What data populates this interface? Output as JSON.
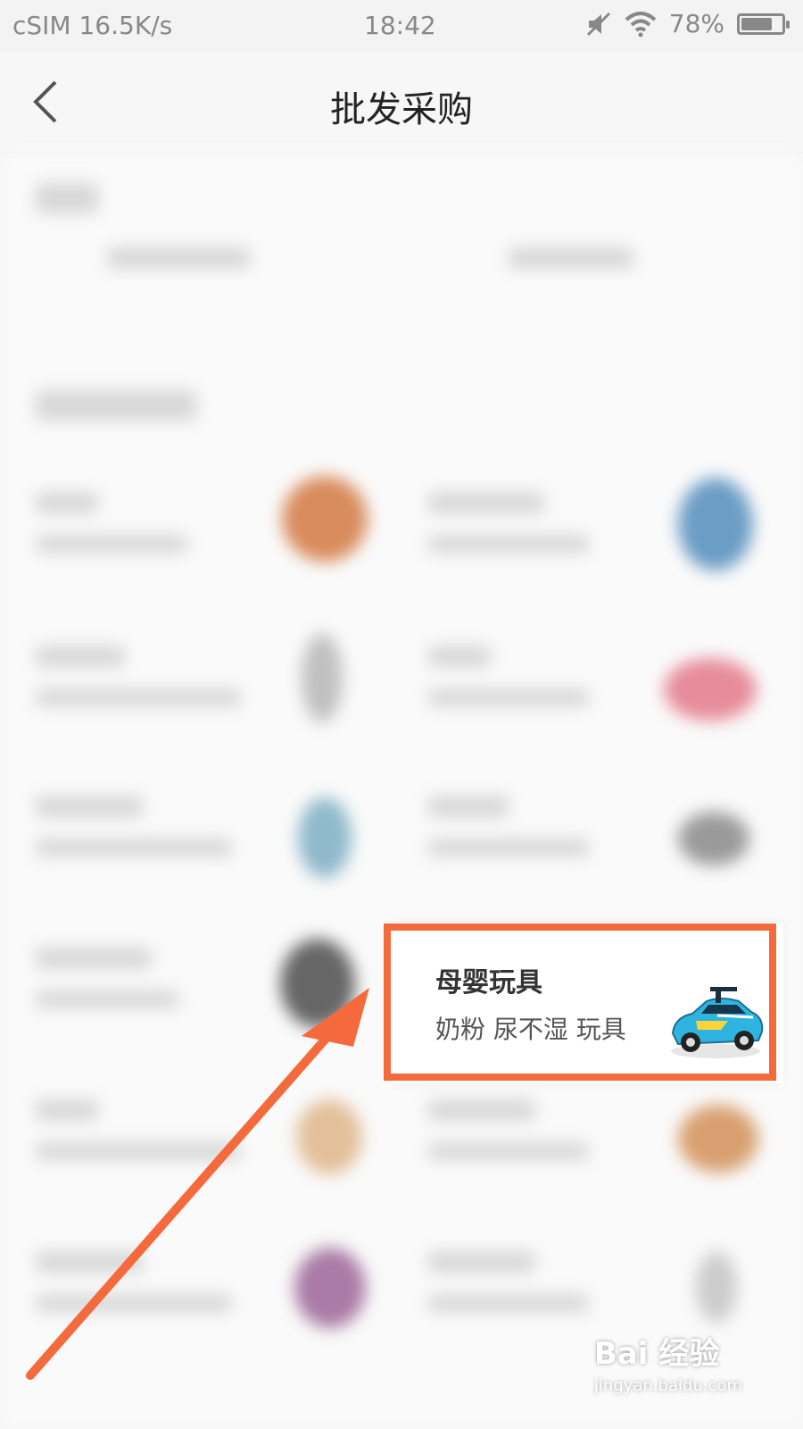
{
  "status_bar": {
    "carrier": "cSIM 16.5K/s",
    "time": "18:42",
    "battery": "78%",
    "battery_level": 0.78
  },
  "nav": {
    "title": "批发采购"
  },
  "featured_card": {
    "title": "母婴玩具",
    "subtitle": "奶粉 尿不湿 玩具"
  },
  "watermark": {
    "brand": "Bai 经验",
    "url": "jingyan.baidu.com"
  },
  "colors": {
    "highlight": "#f56a3c"
  }
}
